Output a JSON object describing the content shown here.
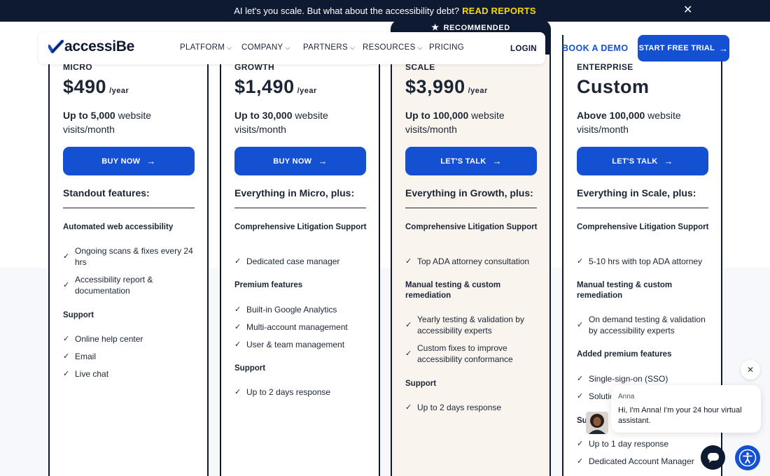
{
  "banner": {
    "text": "AI let's you scale. But what about the accessibility debt?",
    "cta": "READ REPORTS",
    "close_icon": "close-icon"
  },
  "nav": {
    "logo_text": "accessiBe",
    "items": [
      {
        "label": "PLATFORM",
        "dropdown": true
      },
      {
        "label": "COMPANY",
        "dropdown": true
      },
      {
        "label": "PARTNERS",
        "dropdown": true
      },
      {
        "label": "RESOURCES",
        "dropdown": true
      },
      {
        "label": "PRICING",
        "dropdown": false
      }
    ],
    "login": "LOGIN",
    "book_demo": "BOOK A DEMO",
    "start_trial": "START FREE TRIAL"
  },
  "recommended": "RECOMMENDED",
  "plans": [
    {
      "tier": "MICRO",
      "price": "$490",
      "per": "/year",
      "visits_bold": "Up to 5,000",
      "visits_rest": " website visits/month",
      "button": "BUY NOW",
      "features_heading": "Standout features:",
      "sections": [
        {
          "title": "Automated web accessibility",
          "items": [
            "Ongoing scans & fixes every 24 hrs",
            "Accessibility report & documentation"
          ]
        },
        {
          "title": "Support",
          "items": [
            "Online help center",
            "Email",
            "Live chat"
          ]
        }
      ]
    },
    {
      "tier": "GROWTH",
      "price": "$1,490",
      "per": "/year",
      "visits_bold": "Up to 30,000",
      "visits_rest": " website visits/month",
      "button": "BUY NOW",
      "features_heading": "Everything in Micro, plus:",
      "sections": [
        {
          "title": "Comprehensive Litigation Support",
          "items": [
            "Dedicated case manager"
          ]
        },
        {
          "title": "Premium features",
          "items": [
            "Built-in Google Analytics",
            "Multi-account management",
            "User & team management"
          ]
        },
        {
          "title": "Support",
          "items": [
            "Up to 2 days response"
          ]
        }
      ]
    },
    {
      "tier": "SCALE",
      "price": "$3,990",
      "per": "/year",
      "visits_bold": "Up to 100,000",
      "visits_rest": " website visits/month",
      "button": "LET'S TALK",
      "features_heading": "Everything in Growth, plus:",
      "sections": [
        {
          "title": "Comprehensive Litigation Support",
          "items": [
            "Top ADA attorney consultation"
          ]
        },
        {
          "title": "Manual testing & custom remediation",
          "items": [
            "Yearly testing & validation by accessibility experts",
            "Custom fixes to improve accessibility conformance"
          ]
        },
        {
          "title": "Support",
          "items": [
            "Up to 2 days response"
          ]
        }
      ]
    },
    {
      "tier": "ENTERPRISE",
      "price": "Custom",
      "per": "",
      "visits_bold": "Above 100,000",
      "visits_rest": " website visits/month",
      "button": "LET'S TALK",
      "features_heading": "Everything in Scale, plus:",
      "sections": [
        {
          "title": "Comprehensive Litigation Support",
          "items": [
            "5-10 hrs with top ADA attorney"
          ]
        },
        {
          "title": "Manual testing & custom remediation",
          "items": [
            "On demand testing & validation by accessibility experts"
          ]
        },
        {
          "title": "Added premium features",
          "items": [
            "Single-sign-on (SSO)",
            "Solutio"
          ]
        },
        {
          "title": "Su",
          "items": [
            "Up to 1 day response",
            "Dedicated Account Manager"
          ]
        }
      ]
    }
  ],
  "chat": {
    "agent_name": "Anna",
    "message": "Hi, I'm Anna! I'm your 24 hour virtual assistant."
  },
  "colors": {
    "navy": "#0e1932",
    "blue": "#1450d2",
    "yellow": "#f5d90a",
    "recommended_bg": "#faf4ef"
  }
}
